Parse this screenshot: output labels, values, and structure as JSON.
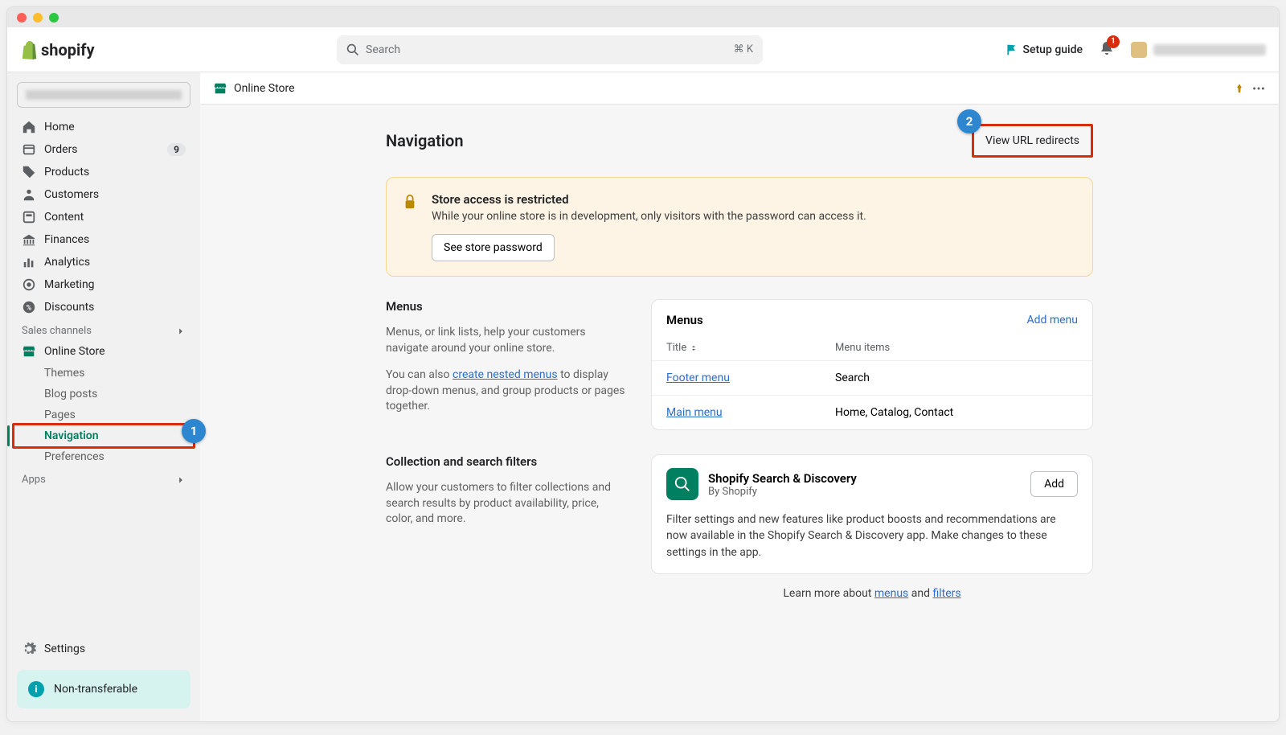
{
  "brand": "shopify",
  "search": {
    "placeholder": "Search",
    "kbd": "⌘ K"
  },
  "topbar": {
    "setup_guide": "Setup guide",
    "notif_count": "1"
  },
  "sidebar": {
    "items": [
      {
        "label": "Home"
      },
      {
        "label": "Orders",
        "badge": "9"
      },
      {
        "label": "Products"
      },
      {
        "label": "Customers"
      },
      {
        "label": "Content"
      },
      {
        "label": "Finances"
      },
      {
        "label": "Analytics"
      },
      {
        "label": "Marketing"
      },
      {
        "label": "Discounts"
      }
    ],
    "sales_channels_label": "Sales channels",
    "online_store_label": "Online Store",
    "sub_items": [
      {
        "label": "Themes"
      },
      {
        "label": "Blog posts"
      },
      {
        "label": "Pages"
      },
      {
        "label": "Navigation"
      },
      {
        "label": "Preferences"
      }
    ],
    "apps_label": "Apps",
    "settings_label": "Settings",
    "non_transferable": "Non-transferable"
  },
  "breadcrumb": "Online Store",
  "page": {
    "title": "Navigation",
    "view_redirects": "View URL redirects"
  },
  "alert": {
    "title": "Store access is restricted",
    "body": "While your online store is in development, only visitors with the password can access it.",
    "button": "See store password"
  },
  "menus_section": {
    "heading": "Menus",
    "p1": "Menus, or link lists, help your customers navigate around your online store.",
    "p2_prefix": "You can also ",
    "p2_link": "create nested menus",
    "p2_suffix": " to display drop-down menus, and group products or pages together.",
    "card_title": "Menus",
    "add_menu": "Add menu",
    "col_title": "Title",
    "col_items": "Menu items",
    "rows": [
      {
        "title": "Footer menu",
        "items": "Search"
      },
      {
        "title": "Main menu",
        "items": "Home, Catalog, Contact"
      }
    ]
  },
  "filters_section": {
    "heading": "Collection and search filters",
    "p": "Allow your customers to filter collections and search results by product availability, price, color, and more.",
    "app_title": "Shopify Search & Discovery",
    "app_by": "By Shopify",
    "add": "Add",
    "app_desc": "Filter settings and new features like product boosts and recommendations are now available in the Shopify Search & Discovery app. Make changes to these settings in the app."
  },
  "learn_more": {
    "prefix": "Learn more about ",
    "link1": "menus",
    "mid": " and ",
    "link2": "filters"
  },
  "callouts": {
    "one": "1",
    "two": "2"
  }
}
